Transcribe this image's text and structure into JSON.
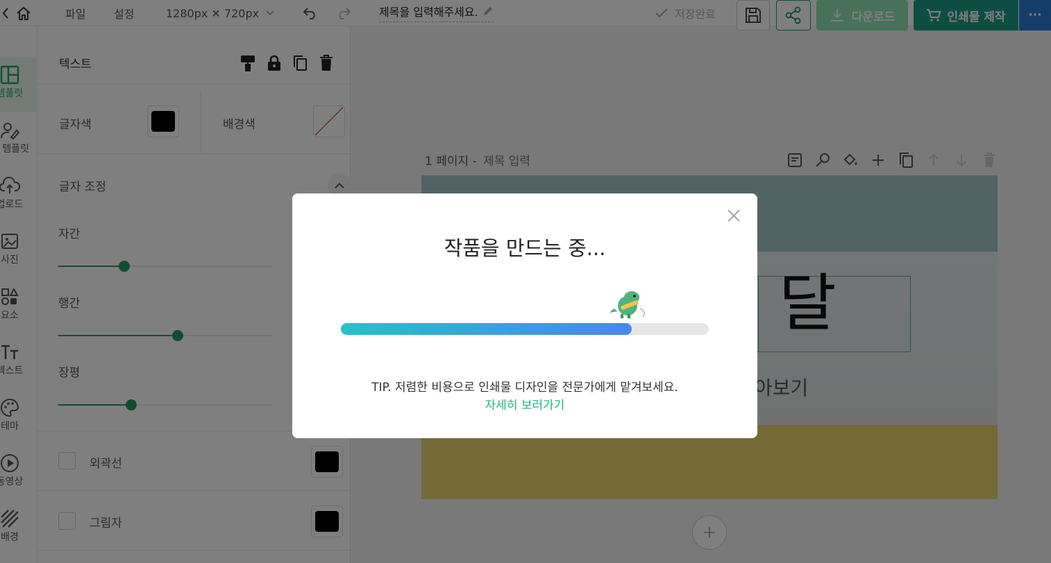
{
  "topbar": {
    "menu_file": "파일",
    "menu_settings": "설정",
    "size_label": "1280px ✕ 720px",
    "doc_title": "제목을 입력해주세요.",
    "save_status": "저장완료",
    "download_label": "다운로드",
    "print_label": "인쇄물 제작",
    "more_label": "···"
  },
  "rail": {
    "items": [
      {
        "label": "템플릿",
        "icon": "layout-icon"
      },
      {
        "label": "내 템플릿",
        "icon": "user-edit-icon"
      },
      {
        "label": "업로드",
        "icon": "cloud-upload-icon"
      },
      {
        "label": "사진",
        "icon": "image-icon"
      },
      {
        "label": "요소",
        "icon": "shapes-icon"
      },
      {
        "label": "텍스트",
        "icon": "text-icon"
      },
      {
        "label": "테마",
        "icon": "palette-icon"
      },
      {
        "label": "동영상",
        "icon": "play-icon"
      },
      {
        "label": "배경",
        "icon": "stripes-icon"
      }
    ]
  },
  "panel": {
    "title": "텍스트",
    "text_color_label": "글자색",
    "bg_color_label": "배경색",
    "adjust_label": "글자 조정",
    "letter_spacing_label": "자간",
    "letter_spacing_value": 0.31,
    "line_height_label": "행간",
    "line_height_value": 0.56,
    "width_label": "장평",
    "width_value": 0.34,
    "outline_label": "외곽선",
    "shadow_label": "그림자"
  },
  "canvas": {
    "page_label": "1 페이지 -",
    "page_title_placeholder": "제목 입력",
    "text_big": "달",
    "text_sub": "아보기"
  },
  "modal": {
    "title": "작품을 만드는 중...",
    "progress": 0.79,
    "tip": "TIP. 저렴한 비용으로 인쇄물 디자인을 전문가에게 맡겨보세요.",
    "link": "자세히 보러가기"
  },
  "colors": {
    "accent": "#1f9a62",
    "download_bg": "#8ee3b3",
    "print_bg": "#1d9c84",
    "more_bg": "#2a7bd6",
    "link": "#1fb67a",
    "progress_start": "#25c1c9",
    "progress_end": "#4a86ee"
  }
}
